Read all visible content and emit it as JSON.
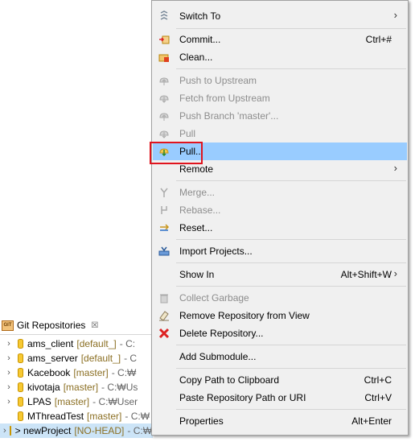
{
  "view": {
    "tab_title": "Git Repositories",
    "tab_close": "☒"
  },
  "repositories": [
    {
      "name": "ams_client",
      "branch": "[default_]",
      "path": "- C:"
    },
    {
      "name": "ams_server",
      "branch": "[default_]",
      "path": "- C"
    },
    {
      "name": "Kacebook",
      "branch": "[master]",
      "path": "- C:₩"
    },
    {
      "name": "kivotaja",
      "branch": "[master]",
      "path": "- C:₩Us"
    },
    {
      "name": "LPAS",
      "branch": "[master]",
      "path": "- C:₩User"
    },
    {
      "name": "MThreadTest",
      "branch": "[master]",
      "path": "- C:₩"
    },
    {
      "name": "> newProject",
      "branch": "[NO-HEAD]",
      "path": "- C:₩Users₩"
    }
  ],
  "menu": {
    "items": [
      {
        "label": "Switch To",
        "shortcut": "",
        "submenu": "›",
        "icon": "switch-icon",
        "disabled": false
      },
      {
        "label": "Commit...",
        "shortcut": "Ctrl+#",
        "icon": "commit-icon",
        "disabled": false
      },
      {
        "label": "Clean...",
        "shortcut": "",
        "icon": "clean-icon",
        "disabled": false
      },
      {
        "label": "Push to Upstream",
        "shortcut": "",
        "icon": "push-icon",
        "disabled": true
      },
      {
        "label": "Fetch from Upstream",
        "shortcut": "",
        "icon": "fetch-icon",
        "disabled": true
      },
      {
        "label": "Push Branch 'master'...",
        "shortcut": "",
        "icon": "push-branch-icon",
        "disabled": true
      },
      {
        "label": "Pull",
        "shortcut": "",
        "icon": "pull-icon",
        "disabled": true
      },
      {
        "label": "Pull...",
        "shortcut": "",
        "icon": "pull-dialog-icon",
        "disabled": false,
        "highlighted": true
      },
      {
        "label": "Remote",
        "shortcut": "",
        "submenu": "›",
        "icon": "",
        "disabled": false
      },
      {
        "label": "Merge...",
        "shortcut": "",
        "icon": "merge-icon",
        "disabled": true
      },
      {
        "label": "Rebase...",
        "shortcut": "",
        "icon": "rebase-icon",
        "disabled": true
      },
      {
        "label": "Reset...",
        "shortcut": "",
        "icon": "reset-icon",
        "disabled": false
      },
      {
        "label": "Import Projects...",
        "shortcut": "",
        "icon": "import-icon",
        "disabled": false
      },
      {
        "label": "Show In",
        "shortcut": "Alt+Shift+W",
        "submenu": "›",
        "icon": "",
        "disabled": false
      },
      {
        "label": "Collect Garbage",
        "shortcut": "",
        "icon": "trash-icon",
        "disabled": true
      },
      {
        "label": "Remove Repository from View",
        "shortcut": "",
        "icon": "eraser-icon",
        "disabled": false
      },
      {
        "label": "Delete Repository...",
        "shortcut": "",
        "icon": "delete-icon",
        "disabled": false
      },
      {
        "label": "Add Submodule...",
        "shortcut": "",
        "icon": "",
        "disabled": false
      },
      {
        "label": "Copy Path to Clipboard",
        "shortcut": "Ctrl+C",
        "icon": "",
        "disabled": false
      },
      {
        "label": "Paste Repository Path or URI",
        "shortcut": "Ctrl+V",
        "icon": "",
        "disabled": false
      },
      {
        "label": "Properties",
        "shortcut": "Alt+Enter",
        "icon": "",
        "disabled": false
      }
    ]
  },
  "colors": {
    "menu_bg": "#f0f0f0",
    "highlight": "#99ccff",
    "callout_border": "#e0141e",
    "disabled_text": "#8d8d8d"
  }
}
